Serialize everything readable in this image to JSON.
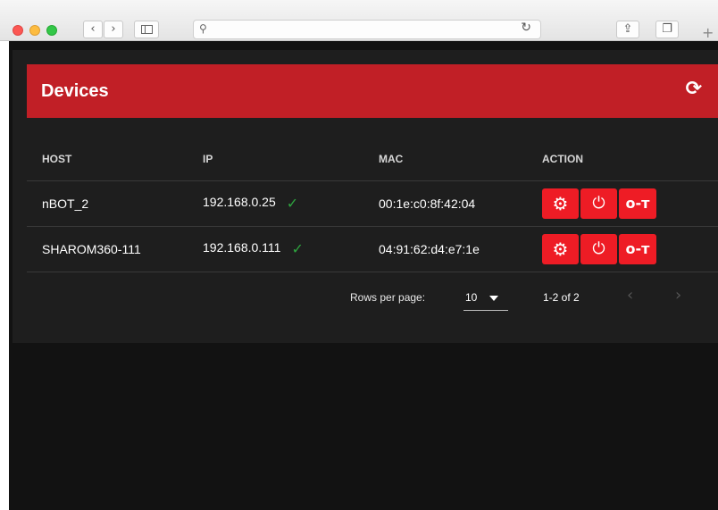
{
  "browser": {
    "back_icon": "chevron-left-icon",
    "forward_icon": "chevron-right-icon",
    "address_value": "",
    "new_tab_icon": "plus-icon"
  },
  "card": {
    "title": "Devices",
    "header_color": "#c11f26",
    "refresh_icon": "refresh-icon"
  },
  "table": {
    "columns": [
      "HOST",
      "IP",
      "MAC",
      "ACTION"
    ],
    "rows": [
      {
        "host": "nBOT_2",
        "ip": "192.168.0.25",
        "mac": "00:1e:c0:8f:42:04",
        "status": "check-icon"
      },
      {
        "host": "SHAROM360-111",
        "ip": "192.168.0.111",
        "mac": "04:91:62:d4:e7:1e",
        "status": "check-icon"
      }
    ],
    "actions": [
      "gear-icon",
      "power-icon",
      "key-icon"
    ],
    "action_color": "#ee1c25"
  },
  "pagination": {
    "rows_per_page_label": "Rows per page:",
    "rows_per_page": "10",
    "range": "1-2 of 2"
  }
}
